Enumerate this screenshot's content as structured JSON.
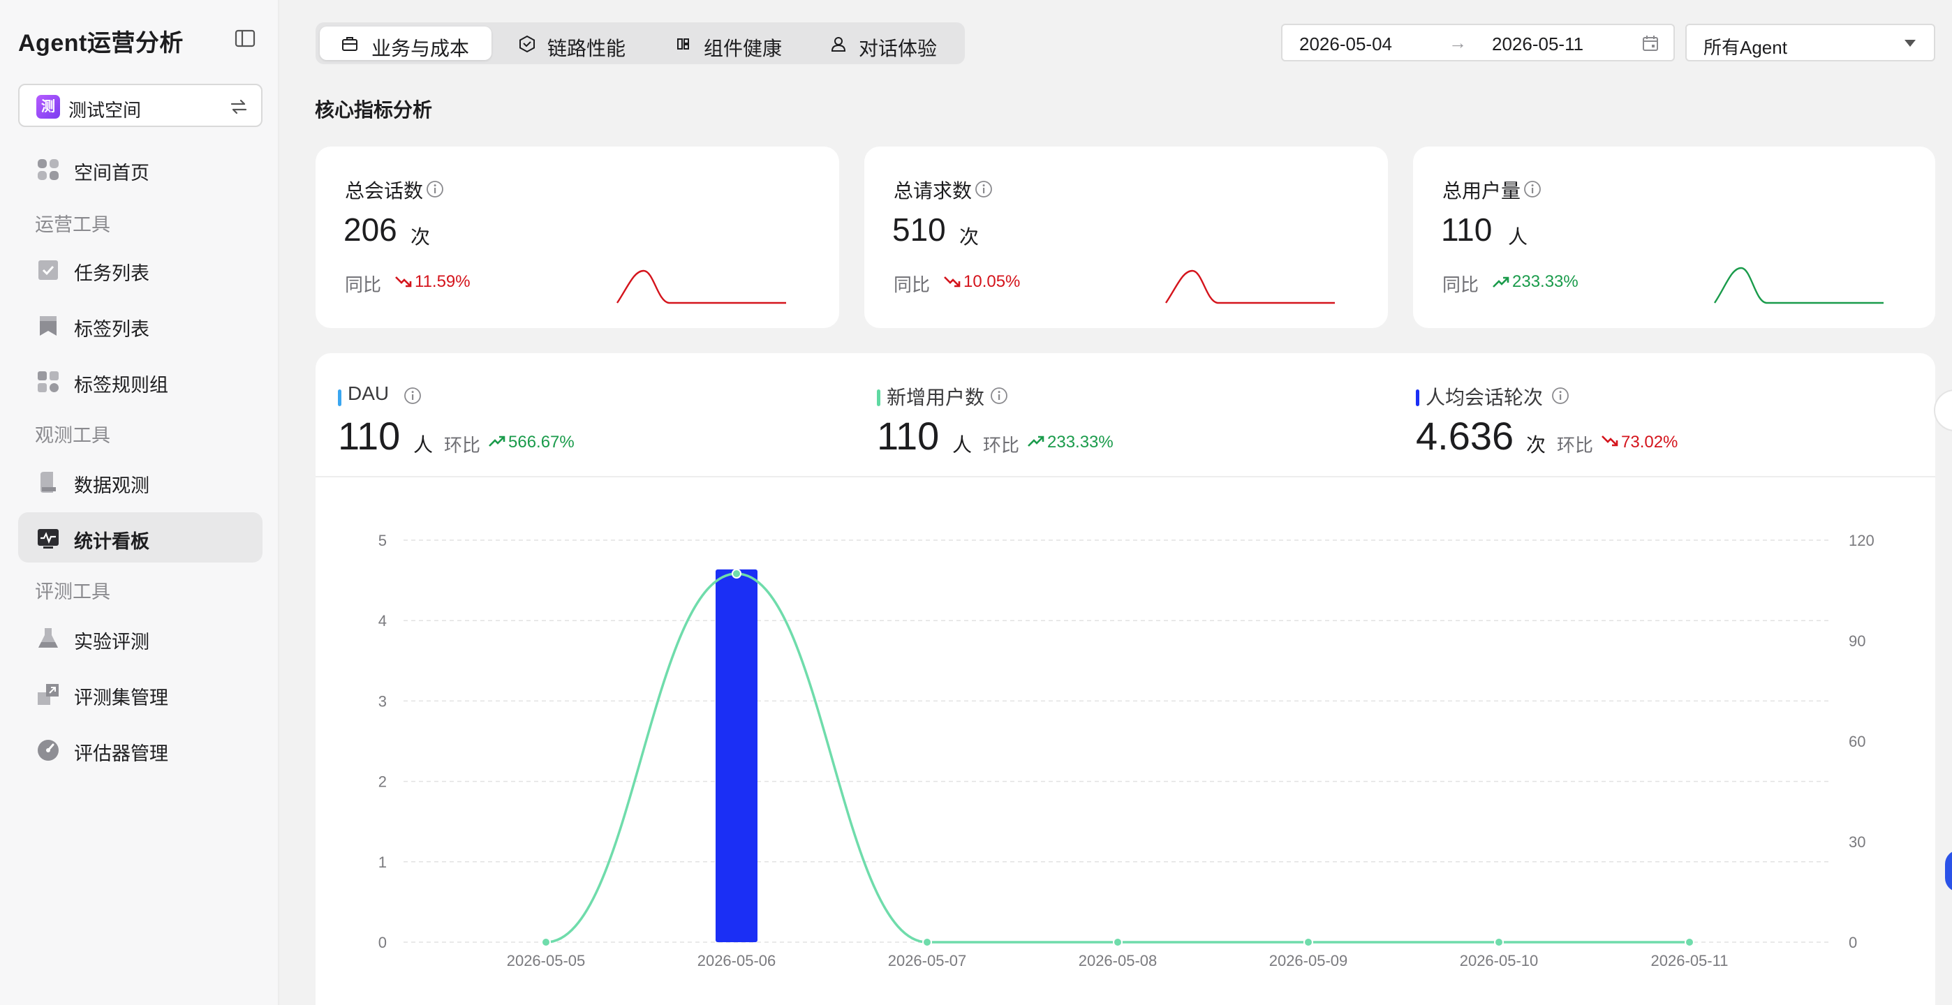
{
  "app": {
    "title": "Agent运营分析"
  },
  "space": {
    "badge": "测",
    "name": "测试空间"
  },
  "sidebar": {
    "items": [
      {
        "label": "空间首页",
        "icon": "home-grid-icon"
      },
      {
        "label": "任务列表",
        "icon": "task-check-icon"
      },
      {
        "label": "标签列表",
        "icon": "tag-icon"
      },
      {
        "label": "标签规则组",
        "icon": "rule-group-icon"
      },
      {
        "label": "数据观测",
        "icon": "data-observe-icon"
      },
      {
        "label": "统计看板",
        "icon": "dashboard-pulse-icon"
      },
      {
        "label": "实验评测",
        "icon": "flask-icon"
      },
      {
        "label": "评测集管理",
        "icon": "dataset-icon"
      },
      {
        "label": "评估器管理",
        "icon": "gauge-icon"
      }
    ],
    "sections": [
      "运营工具",
      "观测工具",
      "评测工具"
    ]
  },
  "tabs": [
    {
      "label": "业务与成本",
      "icon": "briefcase-icon"
    },
    {
      "label": "链路性能",
      "icon": "cube-icon"
    },
    {
      "label": "组件健康",
      "icon": "component-icon"
    },
    {
      "label": "对话体验",
      "icon": "user-icon"
    }
  ],
  "filters": {
    "date_start": "2026-05-04",
    "arrow": "→",
    "date_end": "2026-05-11",
    "agent": "所有Agent"
  },
  "section_title": "核心指标分析",
  "cards": [
    {
      "title": "总会话数",
      "value": "206",
      "unit": "次",
      "cmp_label": "同比",
      "cmp_value": "11.59%",
      "direction": "down"
    },
    {
      "title": "总请求数",
      "value": "510",
      "unit": "次",
      "cmp_label": "同比",
      "cmp_value": "10.05%",
      "direction": "down"
    },
    {
      "title": "总用户量",
      "value": "110",
      "unit": "人",
      "cmp_label": "同比",
      "cmp_value": "233.33%",
      "direction": "up"
    }
  ],
  "metrics": [
    {
      "title": "DAU",
      "value": "110",
      "unit": "人",
      "cmp_label": "环比",
      "cmp_value": "566.67%",
      "direction": "up",
      "color": "#3aa6f0"
    },
    {
      "title": "新增用户数",
      "value": "110",
      "unit": "人",
      "cmp_label": "环比",
      "cmp_value": "233.33%",
      "direction": "up",
      "color": "#5fd9a2"
    },
    {
      "title": "人均会话轮次",
      "value": "4.636",
      "unit": "次",
      "cmp_label": "环比",
      "cmp_value": "73.02%",
      "direction": "down",
      "color": "#1b2ff5"
    }
  ],
  "colors": {
    "red": "#d4141c",
    "green": "#1a9b4b",
    "bar": "#1b2ff5",
    "line": "#6fdcab"
  },
  "chart_data": {
    "type": "bar",
    "categories": [
      "2026-05-05",
      "2026-05-06",
      "2026-05-07",
      "2026-05-08",
      "2026-05-09",
      "2026-05-10",
      "2026-05-11"
    ],
    "series": [
      {
        "name": "人均会话轮次",
        "type": "bar",
        "axis": "left",
        "values": [
          0,
          4.636,
          0,
          0,
          0,
          0,
          0
        ]
      },
      {
        "name": "新增用户数",
        "type": "line",
        "axis": "right",
        "values": [
          0,
          110,
          0,
          0,
          0,
          0,
          0
        ]
      }
    ],
    "ylim_left": [
      0,
      5
    ],
    "yticks_left": [
      "0",
      "1",
      "2",
      "3",
      "4",
      "5"
    ],
    "ylim_right": [
      0,
      120
    ],
    "yticks_right": [
      "0",
      "30",
      "60",
      "90",
      "120"
    ],
    "grid": true
  }
}
